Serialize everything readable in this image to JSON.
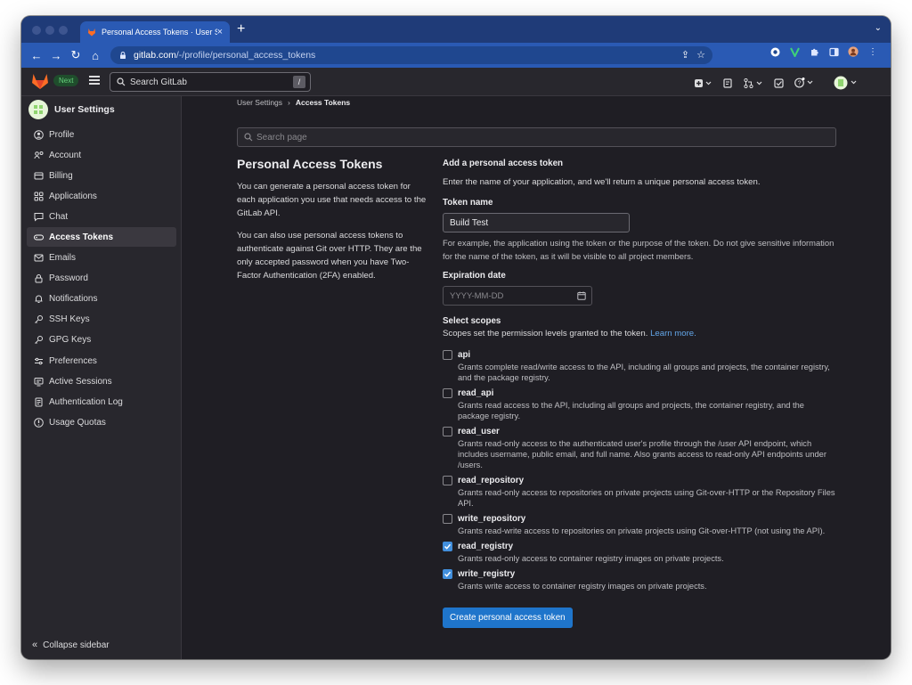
{
  "browser": {
    "tab_title": "Personal Access Tokens · User Settings · GitLab",
    "tab_close": "×",
    "new_tab": "+",
    "url_host": "gitlab.com",
    "url_path": "/-/profile/personal_access_tokens"
  },
  "header": {
    "next_badge": "Next",
    "search_placeholder": "Search GitLab",
    "search_shortcut": "/"
  },
  "sidebar": {
    "title": "User Settings",
    "items": [
      {
        "label": "Profile",
        "icon": "profile-icon"
      },
      {
        "label": "Account",
        "icon": "account-icon"
      },
      {
        "label": "Billing",
        "icon": "billing-icon"
      },
      {
        "label": "Applications",
        "icon": "applications-icon"
      },
      {
        "label": "Chat",
        "icon": "chat-icon"
      },
      {
        "label": "Access Tokens",
        "icon": "token-icon",
        "active": true
      },
      {
        "label": "Emails",
        "icon": "mail-icon"
      },
      {
        "label": "Password",
        "icon": "lock-icon"
      },
      {
        "label": "Notifications",
        "icon": "bell-icon"
      },
      {
        "label": "SSH Keys",
        "icon": "key-icon"
      },
      {
        "label": "GPG Keys",
        "icon": "key-icon"
      },
      {
        "label": "Preferences",
        "icon": "preferences-icon"
      },
      {
        "label": "Active Sessions",
        "icon": "sessions-icon"
      },
      {
        "label": "Authentication Log",
        "icon": "log-icon"
      },
      {
        "label": "Usage Quotas",
        "icon": "quota-icon"
      }
    ],
    "collapse_label": "Collapse sidebar"
  },
  "breadcrumb": {
    "parent": "User Settings",
    "separator": "›",
    "current": "Access Tokens"
  },
  "page_search": {
    "placeholder": "Search page"
  },
  "left": {
    "title": "Personal Access Tokens",
    "p1": "You can generate a personal access token for each application you use that needs access to the GitLab API.",
    "p2": "You can also use personal access tokens to authenticate against Git over HTTP. They are the only accepted password when you have Two-Factor Authentication (2FA) enabled."
  },
  "form": {
    "heading": "Add a personal access token",
    "intro": "Enter the name of your application, and we'll return a unique personal access token.",
    "token_name_label": "Token name",
    "token_name_value": "Build Test",
    "token_name_help": "For example, the application using the token or the purpose of the token. Do not give sensitive information for the name of the token, as it will be visible to all project members.",
    "expiration_label": "Expiration date",
    "expiration_placeholder": "YYYY-MM-DD",
    "scopes_label": "Select scopes",
    "scopes_help": "Scopes set the permission levels granted to the token.",
    "scopes_link": "Learn more.",
    "scopes": [
      {
        "name": "api",
        "desc": "Grants complete read/write access to the API, including all groups and projects, the container registry, and the package registry.",
        "checked": false
      },
      {
        "name": "read_api",
        "desc": "Grants read access to the API, including all groups and projects, the container registry, and the package registry.",
        "checked": false
      },
      {
        "name": "read_user",
        "desc": "Grants read-only access to the authenticated user's profile through the /user API endpoint, which includes username, public email, and full name. Also grants access to read-only API endpoints under /users.",
        "checked": false
      },
      {
        "name": "read_repository",
        "desc": "Grants read-only access to repositories on private projects using Git-over-HTTP or the Repository Files API.",
        "checked": false
      },
      {
        "name": "write_repository",
        "desc": "Grants read-write access to repositories on private projects using Git-over-HTTP (not using the API).",
        "checked": false
      },
      {
        "name": "read_registry",
        "desc": "Grants read-only access to container registry images on private projects.",
        "checked": true
      },
      {
        "name": "write_registry",
        "desc": "Grants write access to container registry images on private projects.",
        "checked": true
      }
    ],
    "submit_label": "Create personal access token"
  },
  "colors": {
    "accent": "#1f75cb",
    "link": "#63a6e9",
    "checkbox_on": "#428fdc"
  }
}
